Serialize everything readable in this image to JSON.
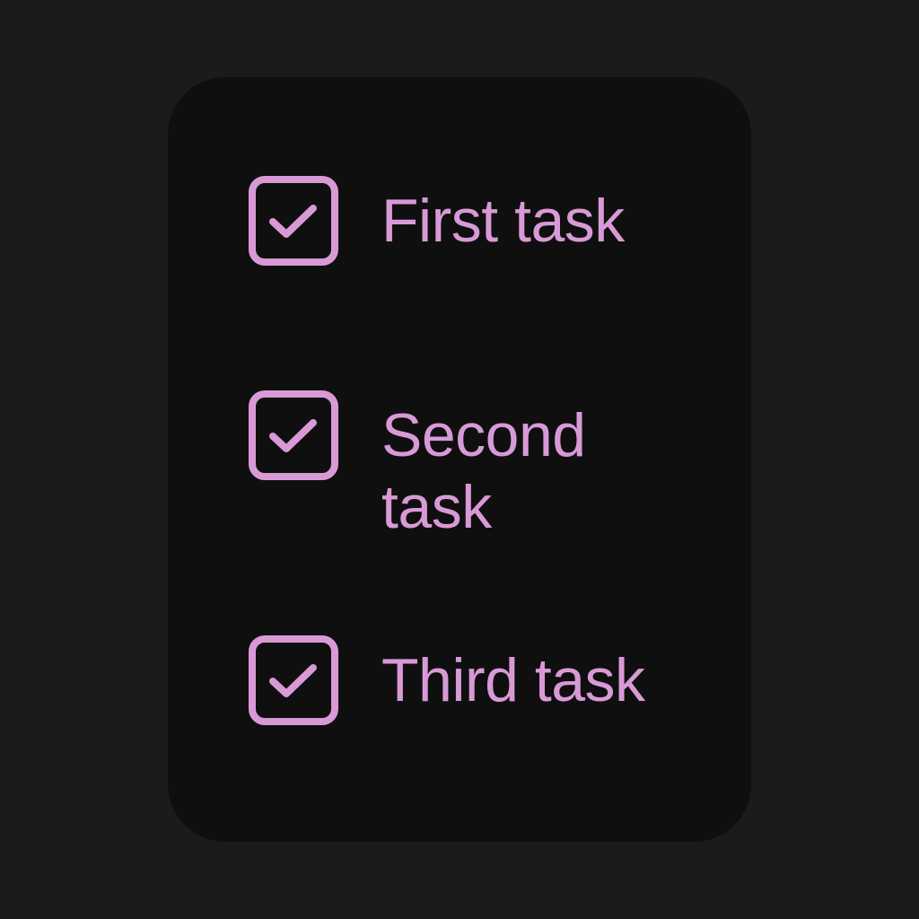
{
  "theme": {
    "background": "#1b1b1b",
    "card_background": "#0f0f0f",
    "accent": "#d89ad6"
  },
  "tasks": [
    {
      "label": "First task",
      "checked": true,
      "icon": "checkmark-icon"
    },
    {
      "label": "Second task",
      "checked": true,
      "icon": "checkmark-icon"
    },
    {
      "label": "Third task",
      "checked": true,
      "icon": "checkmark-icon"
    }
  ]
}
